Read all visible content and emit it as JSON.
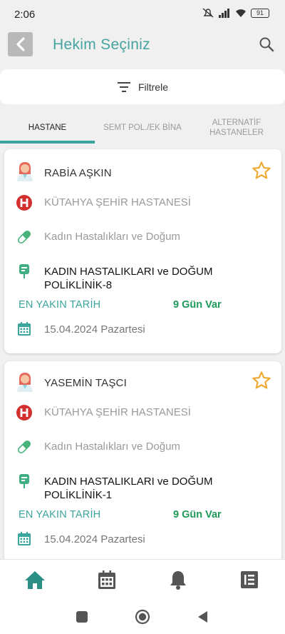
{
  "status_bar": {
    "time": "2:06",
    "battery": "91"
  },
  "header": {
    "title": "Hekim Seçiniz"
  },
  "filter": {
    "label": "Filtrele"
  },
  "tabs": [
    {
      "label": "HASTANE"
    },
    {
      "label": "SEMT POL./EK BİNA"
    },
    {
      "label": "ALTERNATİF HASTANELER"
    }
  ],
  "cards": [
    {
      "doctor": "RABİA AŞKIN",
      "hospital": "KÜTAHYA ŞEHİR HASTANESİ",
      "branch": "Kadın Hastalıkları ve Doğum",
      "clinic_line1": "KADIN HASTALIKLARI ve DOĞUM",
      "clinic_line2": "POLİKLİNİK-8",
      "nearest_label": "EN YAKIN TARİH",
      "nearest_value": "9 Gün Var",
      "date": "15.04.2024 Pazartesi"
    },
    {
      "doctor": "YASEMİN TAŞCI",
      "hospital": "KÜTAHYA ŞEHİR HASTANESİ",
      "branch": "Kadın Hastalıkları ve Doğum",
      "clinic_line1": "KADIN HASTALIKLARI ve DOĞUM",
      "clinic_line2": "POLİKLİNİK-1",
      "nearest_label": "EN YAKIN TARİH",
      "nearest_value": "9 Gün Var",
      "date": "15.04.2024 Pazartesi"
    }
  ],
  "colors": {
    "accent": "#3aa59c",
    "title": "#45a4a0",
    "nearest": "#1e9a5a",
    "star": "#f0a830",
    "hospital_red": "#d32f2f"
  },
  "icons": {
    "back": "chevron-left-icon",
    "search": "search-icon",
    "filter": "filter-icon",
    "star": "star-outline-icon",
    "avatar": "female-doctor-icon",
    "hospital": "hospital-h-icon",
    "branch": "pill-icon",
    "clinic": "iv-bag-icon",
    "date": "calendar-icon",
    "nav": [
      "home-icon",
      "calendar-icon",
      "bell-icon",
      "list-icon"
    ]
  }
}
